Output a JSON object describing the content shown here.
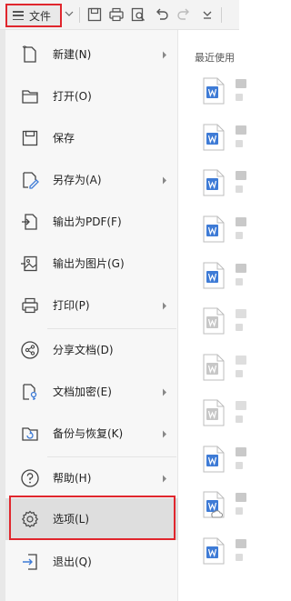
{
  "toolbar": {
    "file_label": "文件",
    "icons": [
      "menu-icon",
      "chevron-down-icon",
      "save-icon",
      "print-icon",
      "print-preview-icon",
      "undo-icon",
      "redo-icon",
      "more-icon"
    ]
  },
  "menu": {
    "items": [
      {
        "label": "新建(N)",
        "icon": "new-doc-icon",
        "submenu": true
      },
      {
        "label": "打开(O)",
        "icon": "folder-open-icon",
        "submenu": false
      },
      {
        "label": "保存",
        "icon": "save-icon",
        "submenu": false
      },
      {
        "label": "另存为(A)",
        "icon": "save-as-icon",
        "submenu": true
      },
      {
        "label": "输出为PDF(F)",
        "icon": "export-pdf-icon",
        "submenu": false
      },
      {
        "label": "输出为图片(G)",
        "icon": "export-image-icon",
        "submenu": false
      },
      {
        "label": "打印(P)",
        "icon": "print-icon",
        "submenu": true
      },
      {
        "label": "分享文档(D)",
        "icon": "share-icon",
        "submenu": false
      },
      {
        "label": "文档加密(E)",
        "icon": "encrypt-icon",
        "submenu": true
      },
      {
        "label": "备份与恢复(K)",
        "icon": "backup-icon",
        "submenu": true
      },
      {
        "label": "帮助(H)",
        "icon": "help-icon",
        "submenu": true
      },
      {
        "label": "选项(L)",
        "icon": "gear-icon",
        "submenu": false,
        "selected": true
      },
      {
        "label": "退出(Q)",
        "icon": "exit-icon",
        "submenu": false
      }
    ]
  },
  "recent": {
    "title": "最近使用",
    "item_count_visible": 11
  },
  "colors": {
    "highlight_border": "#e0262d",
    "doc_blue": "#3e7bd6",
    "doc_faded": "#c7c7c7"
  }
}
